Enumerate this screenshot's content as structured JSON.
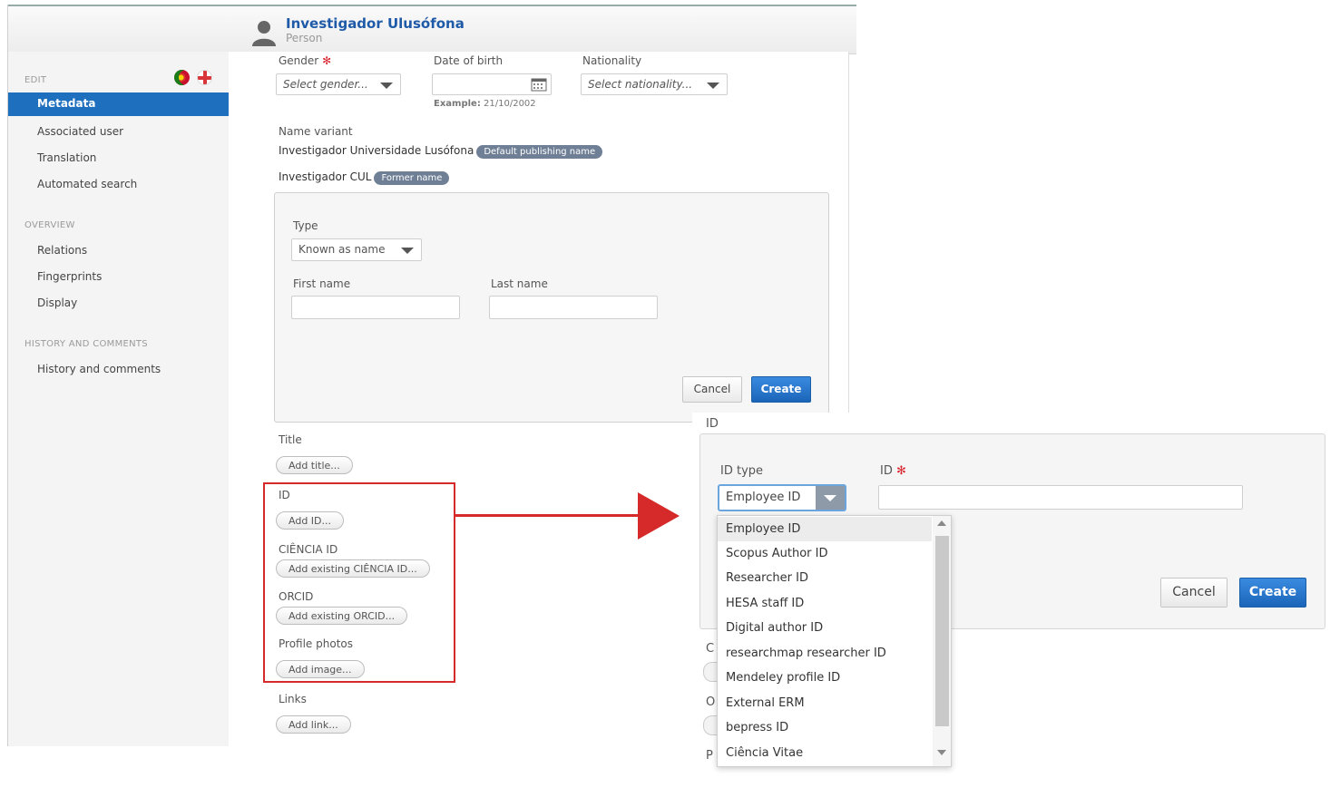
{
  "header": {
    "name": "Investigador Ulusófona",
    "type": "Person"
  },
  "sidebar": {
    "edit_heading": "EDIT",
    "items_edit": [
      "Metadata",
      "Associated user",
      "Translation",
      "Automated search"
    ],
    "overview_heading": "OVERVIEW",
    "items_overview": [
      "Relations",
      "Fingerprints",
      "Display"
    ],
    "history_heading": "HISTORY AND COMMENTS",
    "items_history": [
      "History and comments"
    ]
  },
  "form": {
    "gender_label": "Gender",
    "gender_placeholder": "Select gender...",
    "dob_label": "Date of birth",
    "dob_example_prefix": "Example:",
    "dob_example_value": "21/10/2002",
    "nationality_label": "Nationality",
    "nationality_placeholder": "Select nationality...",
    "name_variant_label": "Name variant",
    "name_variants": [
      {
        "name": "Investigador Universidade Lusófona",
        "tag": "Default publishing name"
      },
      {
        "name": "Investigador CUL",
        "tag": "Former name"
      }
    ],
    "type_label": "Type",
    "type_value": "Known as name",
    "first_name_label": "First name",
    "last_name_label": "Last name",
    "cancel": "Cancel",
    "create": "Create",
    "title_label": "Title",
    "add_title": "Add title...",
    "id_label": "ID",
    "add_id": "Add ID...",
    "ciencia_label": "CIÊNCIA ID",
    "add_ciencia": "Add existing CIÊNCIA ID...",
    "orcid_label": "ORCID",
    "add_orcid": "Add existing ORCID...",
    "photos_label": "Profile photos",
    "add_image": "Add image...",
    "links_label": "Links",
    "add_link": "Add link..."
  },
  "zoom": {
    "section_label": "ID",
    "id_type_label": "ID type",
    "id_label": "ID",
    "selected": "Employee ID",
    "options": [
      "Employee ID",
      "Scopus Author ID",
      "Researcher ID",
      "HESA staff ID",
      "Digital author ID",
      "researchmap researcher ID",
      "Mendeley profile ID",
      "External ERM",
      "bepress ID",
      "Ciência Vitae"
    ],
    "cancel": "Cancel",
    "create": "Create",
    "obscured_letters": [
      "C",
      "O",
      "P"
    ]
  },
  "colors": {
    "accent": "#1e6fbd",
    "highlight": "#d62a2a",
    "required": "#d9232d"
  }
}
